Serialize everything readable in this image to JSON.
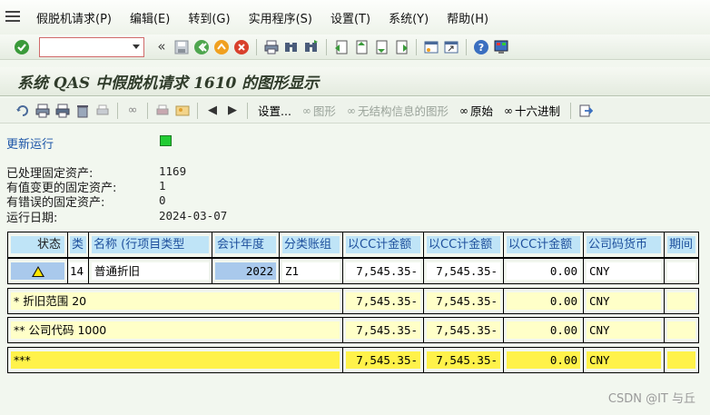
{
  "menu": {
    "items": [
      "假脱机请求(P)",
      "编辑(E)",
      "转到(G)",
      "实用程序(S)",
      "设置(T)",
      "系统(Y)",
      "帮助(H)"
    ]
  },
  "toolbar": {
    "command_value": "",
    "icons": [
      "check-icon",
      "command-field",
      "back-icon",
      "save-icon",
      "back-nav-icon",
      "exit-icon",
      "cancel-icon",
      "print-icon",
      "find-icon",
      "find-next-icon",
      "first-page-icon",
      "prev-page-icon",
      "next-page-icon",
      "last-page-icon",
      "new-session-icon",
      "shortcut-icon",
      "help-icon",
      "layout-icon"
    ]
  },
  "title": "系统 QAS 中假脱机请求 1610 的图形显示",
  "app_toolbar": {
    "settings_label": "设置...",
    "graphic_label": "图形",
    "unstructured_label": "无结构信息的图形",
    "raw_label": "原始",
    "hex_label": "十六进制"
  },
  "status": {
    "update_run_label": "更新运行",
    "update_run_color": "#22cc33",
    "processed_label": "已处理固定资产:",
    "processed_value": "1169",
    "changed_label": "有值变更的固定资产:",
    "changed_value": "1",
    "error_label": "有错误的固定资产:",
    "error_value": "0",
    "run_date_label": "运行日期:",
    "run_date_value": "2024-03-07"
  },
  "grid": {
    "headers": [
      "状态",
      "类",
      "名称 (行项目类型",
      "会计年度",
      "分类账组",
      "以CC计金额",
      "以CC计金额",
      "以CC计金额",
      "公司码货币",
      "期间"
    ],
    "rows": [
      {
        "status": "warning",
        "type": "14",
        "name": "普通折旧",
        "year": "2022",
        "ledger_group": "Z1",
        "amount1": "7,545.35-",
        "amount2": "7,545.35-",
        "amount3": "0.00",
        "currency": "CNY",
        "period": ""
      },
      {
        "label": "*  折旧范围 20",
        "amount1": "7,545.35-",
        "amount2": "7,545.35-",
        "amount3": "0.00",
        "currency": "CNY"
      },
      {
        "label": "** 公司代码 1000",
        "amount1": "7,545.35-",
        "amount2": "7,545.35-",
        "amount3": "0.00",
        "currency": "CNY"
      },
      {
        "label": "***",
        "amount1": "7,545.35-",
        "amount2": "7,545.35-",
        "amount3": "0.00",
        "currency": "CNY"
      }
    ]
  },
  "watermark": "CSDN @IT 与丘"
}
